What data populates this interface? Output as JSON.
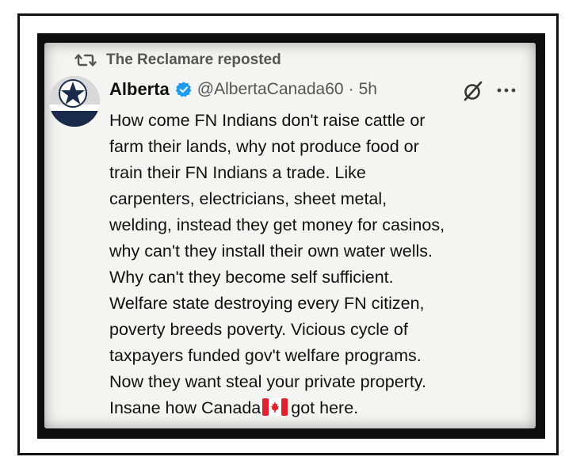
{
  "repost": {
    "icon": "repost-icon",
    "text": "The Reclamare reposted"
  },
  "author": {
    "display_name": "Alberta",
    "handle": "@AlbertaCanada60",
    "separator": "·",
    "time": "5h",
    "verified_icon": "verified-badge-icon",
    "avatar": "dallas-star-avatar"
  },
  "actions": {
    "grok_icon": "grok-icon",
    "more_icon": "more-options-icon"
  },
  "tweet": {
    "lines": [
      "How come FN Indians don't raise cattle or",
      "farm their lands, why not produce food or",
      "train their FN Indians a trade. Like",
      "carpenters, electricians, sheet metal,",
      "welding,  instead they get money for casinos,",
      "why can't they install their own water wells.",
      "Why can't they become self sufficient.",
      "Welfare state destroying every FN citizen,",
      "poverty breeds poverty.  Vicious cycle of",
      "taxpayers funded gov't welfare programs.",
      "Now they want steal your private property."
    ],
    "last_line_before_flag": "Insane how Canada",
    "flag_icon": "canada-flag-emoji",
    "last_line_after_flag": "got here."
  },
  "colors": {
    "frame": "#111111",
    "card_bg": "#f4f4f2",
    "verified_blue": "#1d9bf0",
    "muted_text": "#555555"
  }
}
